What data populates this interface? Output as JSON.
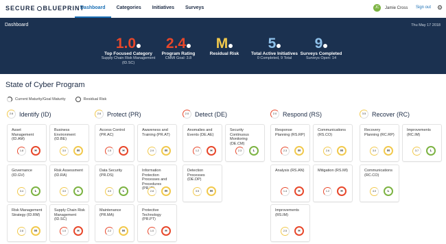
{
  "nav": {
    "logo_left": "SECURE",
    "logo_right": "BLUEPRINT",
    "links": [
      "Dashboard",
      "Categories",
      "Initiatives",
      "Surveys"
    ],
    "active": "Dashboard",
    "user_initials": "JC",
    "user_name": "Jamie Cross",
    "signout": "Sign out",
    "settings_icon": "gear-icon"
  },
  "header": {
    "title": "Dashboard",
    "date": "Thu May 17 2018",
    "kpis": [
      {
        "value": "1.0",
        "label": "Top Focused Category",
        "sub": "Supply Chain Risk Management (ID.SC)",
        "color": "#e8472a"
      },
      {
        "value": "2.4",
        "label": "Program Rating",
        "sub": "CMMI Goal: 3.8",
        "color": "#e8472a"
      },
      {
        "value": "M",
        "label": "Residual Risk",
        "sub": "",
        "color": "#f2c94c"
      },
      {
        "value": "5",
        "label": "Total Active Initiatives",
        "sub": "0 Completed, 9 Total",
        "color": "#8fc1ea"
      },
      {
        "value": "9",
        "label": "Surveys Completed",
        "sub": "Surveys Open: 14",
        "color": "#8fc1ea"
      }
    ]
  },
  "program": {
    "title": "State of Cyber Program",
    "legend_maturity": "Current Maturity/Goal Maturity",
    "legend_risk": "Residual Risk"
  },
  "colors": {
    "H": "#e8472a",
    "M": "#f2c94c",
    "L": "#7cb342",
    "gauge_low": "#e8472a",
    "gauge_mid": "#f2c94c"
  },
  "functions": [
    {
      "name": "Identify (ID)",
      "badge": "2.6"
    },
    {
      "name": "Protect (PR)",
      "badge": "2.6"
    },
    {
      "name": "Detect (DE)",
      "badge": "2.0"
    },
    {
      "name": "Respond (RS)",
      "badge": "2.0"
    },
    {
      "name": "Recover (RC)",
      "badge": "3.5"
    }
  ],
  "categories": [
    {
      "fn": 0,
      "col": 0,
      "row": 0,
      "name": "Asset Management (ID.AM)",
      "score": "1.8",
      "risk": "H"
    },
    {
      "fn": 0,
      "col": 1,
      "row": 0,
      "name": "Business Environment (ID.BE)",
      "score": "3.0",
      "risk": "M"
    },
    {
      "fn": 0,
      "col": 0,
      "row": 1,
      "name": "Governance (ID.GV)",
      "score": "3.4",
      "risk": "L"
    },
    {
      "fn": 0,
      "col": 1,
      "row": 1,
      "name": "Risk Assessment (ID.RA)",
      "score": "3.0",
      "risk": "L"
    },
    {
      "fn": 0,
      "col": 0,
      "row": 2,
      "name": "Risk Management Strategy (ID.RM)",
      "score": "2.8",
      "risk": "M"
    },
    {
      "fn": 0,
      "col": 1,
      "row": 2,
      "name": "Supply Chain Risk Management (ID.SC)",
      "score": "1.0",
      "risk": "H"
    },
    {
      "fn": 1,
      "col": 0,
      "row": 0,
      "name": "Access Control (PR.AC)",
      "score": "1.5",
      "risk": "H"
    },
    {
      "fn": 1,
      "col": 1,
      "row": 0,
      "name": "Awareness and Training (PR.AT)",
      "score": "2.9",
      "risk": "M"
    },
    {
      "fn": 1,
      "col": 0,
      "row": 1,
      "name": "Data Security (PR.DS)",
      "score": "4.0",
      "risk": "L"
    },
    {
      "fn": 1,
      "col": 1,
      "row": 1,
      "name": "Information Protection Processes and Procedures (PR.IP)",
      "score": "2.8",
      "risk": "M"
    },
    {
      "fn": 1,
      "col": 0,
      "row": 2,
      "name": "Maintenance (PR.MA)",
      "score": "2.2",
      "risk": "M"
    },
    {
      "fn": 1,
      "col": 1,
      "row": 2,
      "name": "Protective Technology (PR.PT)",
      "score": "1.0",
      "risk": "H"
    },
    {
      "fn": 2,
      "col": 0,
      "row": 0,
      "name": "Anomalies and Events (DE.AE)",
      "score": "1.2",
      "risk": "H"
    },
    {
      "fn": 2,
      "col": 1,
      "row": 0,
      "name": "Security Continuous Monitoring (DE.CM)",
      "score": "2.3",
      "risk": "L"
    },
    {
      "fn": 2,
      "col": 0,
      "row": 1,
      "name": "Detection Processes (DE.DP)",
      "score": "3.5",
      "risk": "M"
    },
    {
      "fn": 3,
      "col": 0,
      "row": 0,
      "name": "Response Planning (RS.RP)",
      "score": "2.3",
      "risk": "M"
    },
    {
      "fn": 3,
      "col": 1,
      "row": 0,
      "name": "Communications (RS.CO)",
      "score": "2.6",
      "risk": "M"
    },
    {
      "fn": 3,
      "col": 0,
      "row": 1,
      "name": "Analysis (RS.AN)",
      "score": "1.4",
      "risk": "H"
    },
    {
      "fn": 3,
      "col": 1,
      "row": 1,
      "name": "Mitigation (RS.MI)",
      "score": "1.2",
      "risk": "H"
    },
    {
      "fn": 3,
      "col": 0,
      "row": 2,
      "name": "Improvements (RS.IM)",
      "score": "2.5",
      "risk": "H"
    },
    {
      "fn": 4,
      "col": 0,
      "row": 0,
      "name": "Recovery Planning (RC.RP)",
      "score": "3.0",
      "risk": "M"
    },
    {
      "fn": 4,
      "col": 1,
      "row": 0,
      "name": "Improvements (RC.IM)",
      "score": "3.7",
      "risk": "L"
    },
    {
      "fn": 4,
      "col": 0,
      "row": 1,
      "name": "Communications (RC.CO)",
      "score": "4.0",
      "risk": "L"
    }
  ]
}
